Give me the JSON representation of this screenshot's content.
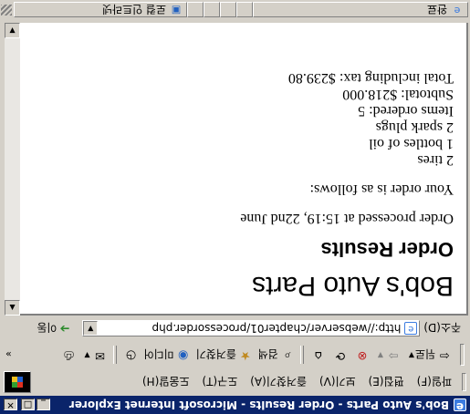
{
  "window": {
    "title": "Bob's Auto Parts - Order Results - Microsoft Internet Explorer",
    "minimize": "_",
    "maximize": "□",
    "close": "✕"
  },
  "menu": {
    "items": [
      {
        "label": "파일(F)"
      },
      {
        "label": "편집(E)"
      },
      {
        "label": "보기(V)"
      },
      {
        "label": "즐겨찾기(A)"
      },
      {
        "label": "도구(T)"
      },
      {
        "label": "도움말(H)"
      }
    ]
  },
  "toolbar": {
    "back_label": "뒤로",
    "search_label": "검색",
    "favorites_label": "즐겨찾기",
    "media_label": "미디어",
    "icons": [
      "back-icon",
      "forward-icon",
      "stop-icon",
      "refresh-icon",
      "home-icon",
      "search-icon",
      "favorites-icon",
      "media-icon",
      "history-icon",
      "mail-icon",
      "print-icon"
    ]
  },
  "address": {
    "label": "주소(D)",
    "url": "http://webserver/chapter01/processorder.php",
    "go_label": "이동"
  },
  "page": {
    "title": "Bob's Auto Parts",
    "subtitle": "Order Results",
    "processed": "Order processed at 15:19, 22nd June",
    "intro": "Your order is as follows:",
    "items": [
      "2 tires",
      "1 bottles of oil",
      "2 spark plugs"
    ],
    "items_ordered": "Items ordered: 5",
    "subtotal": "Subtotal: $218.000",
    "total": "Total including tax: $239.80"
  },
  "status": {
    "left_text": "완료",
    "zone_text": "로컬 인트라넷"
  }
}
